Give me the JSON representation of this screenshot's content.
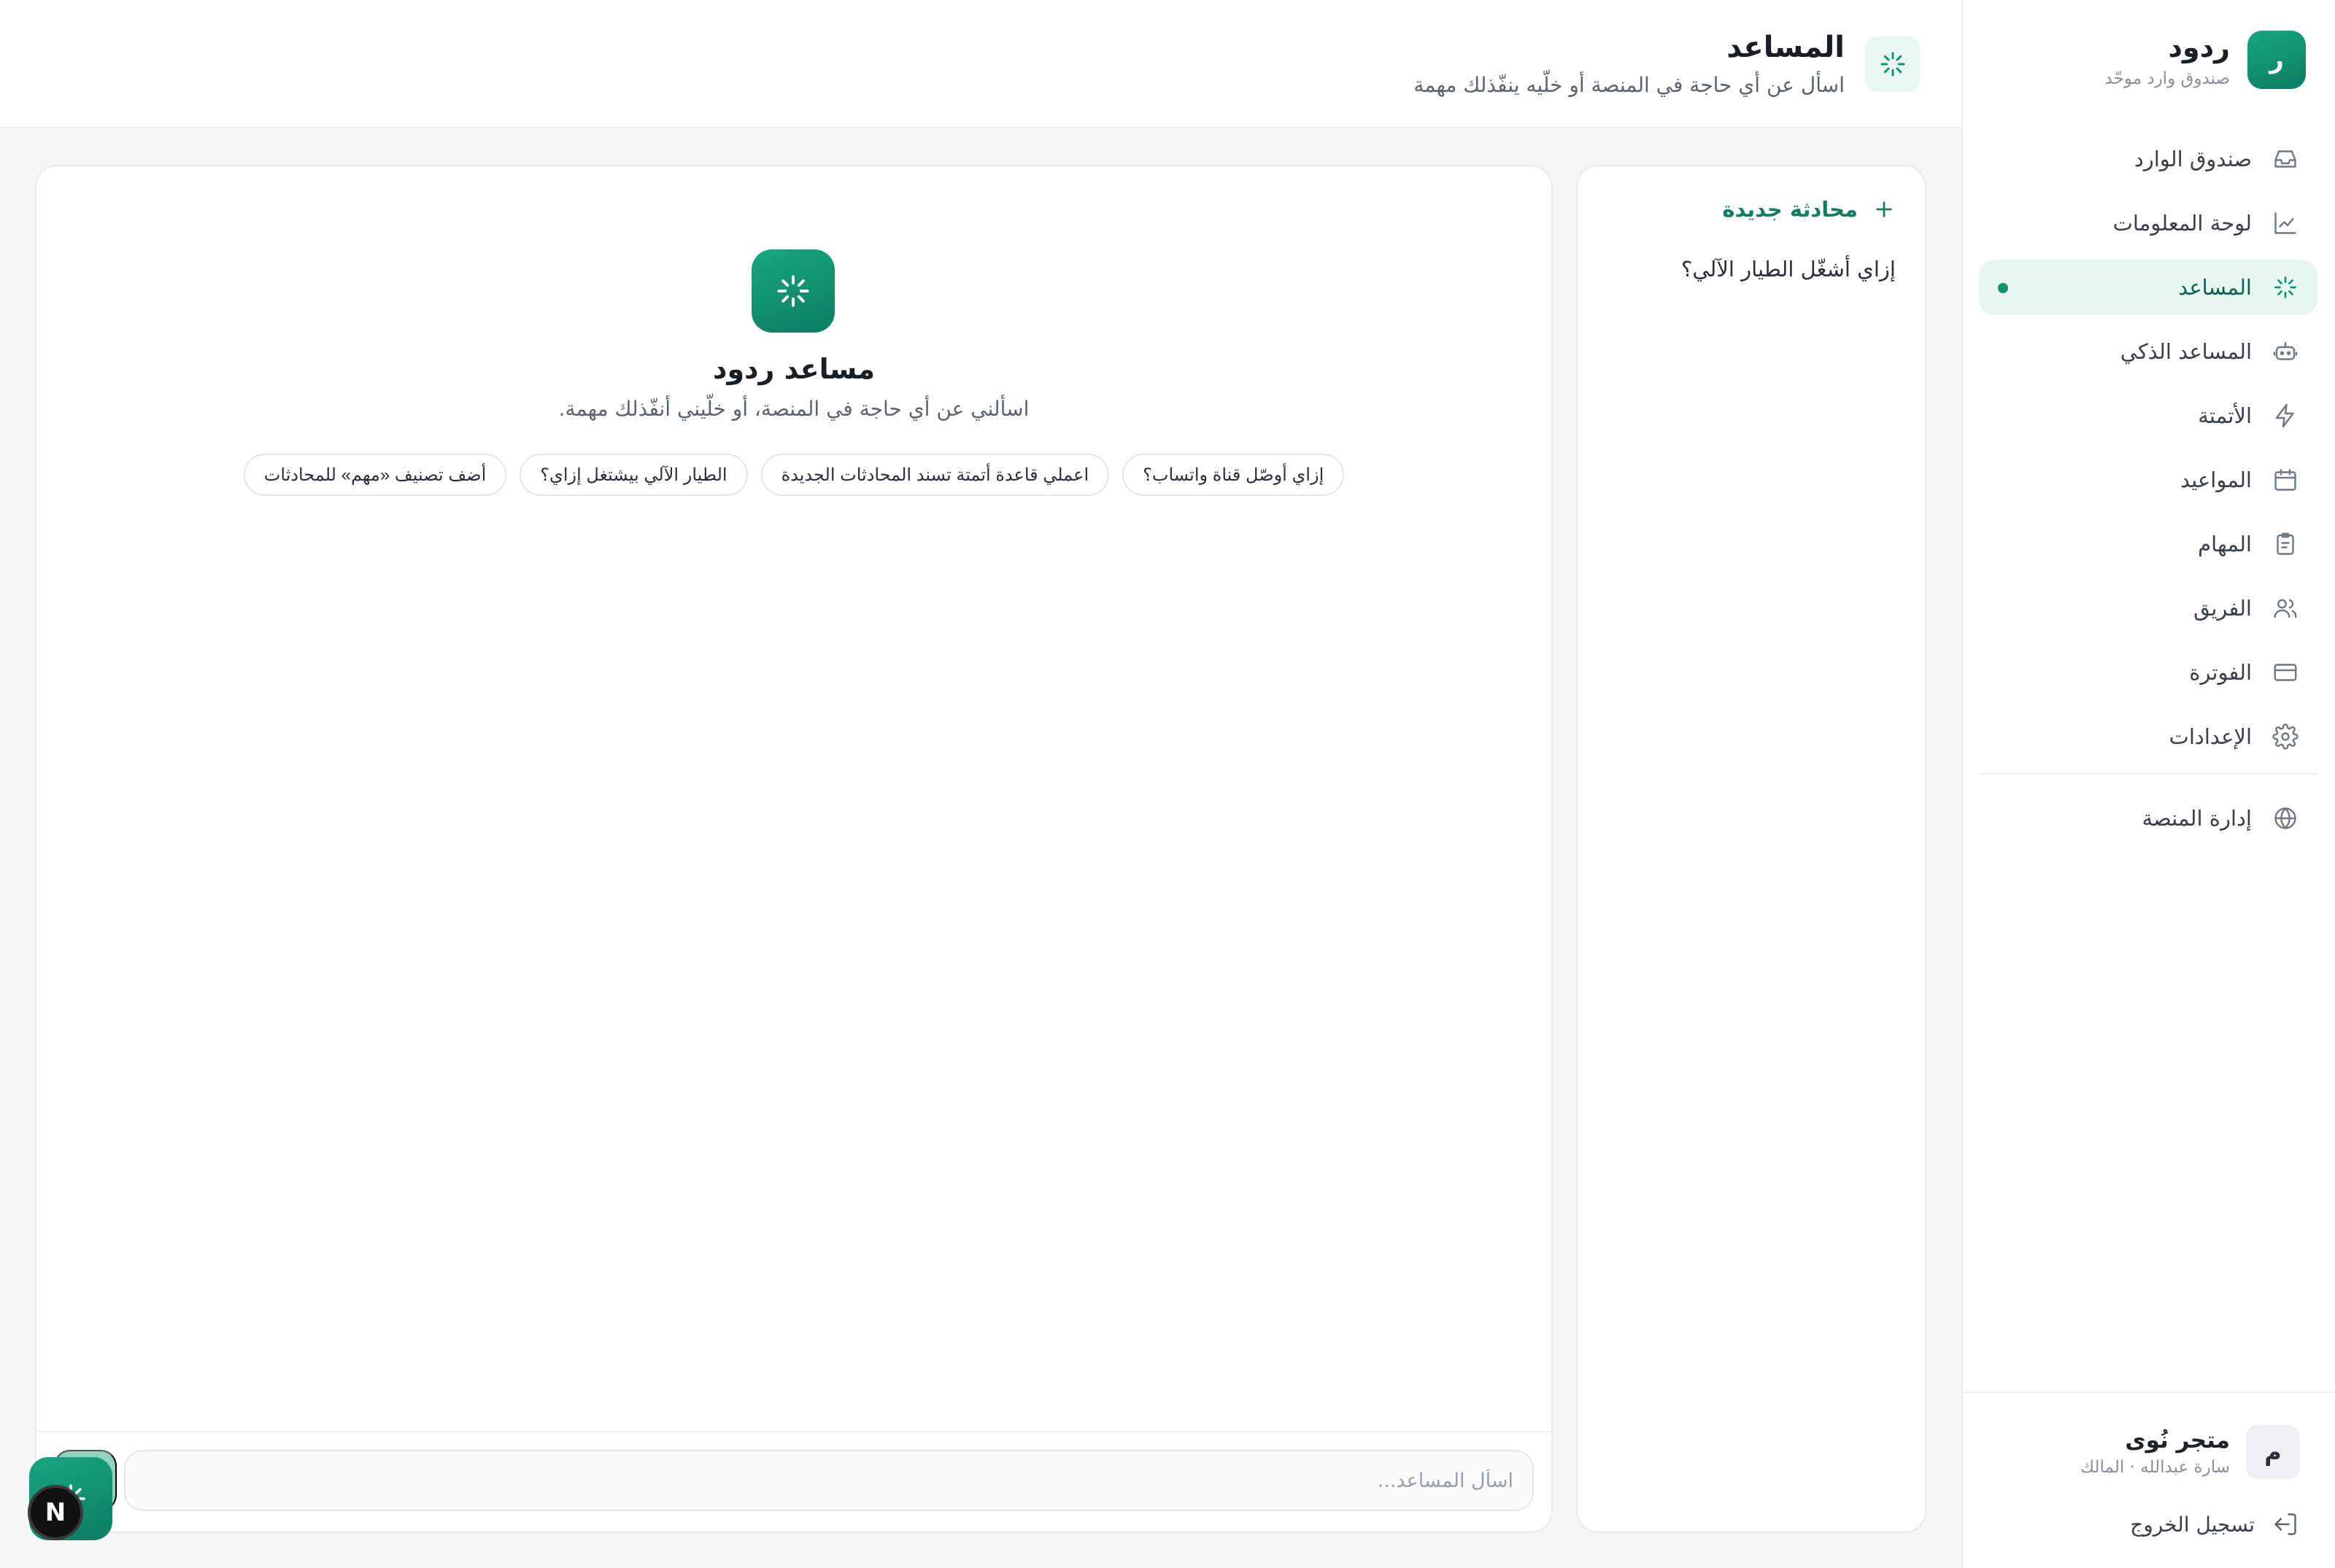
{
  "brand": {
    "name": "ردود",
    "subtitle": "صندوق وارد موحّد",
    "logo_letter": "ر"
  },
  "nav": {
    "items": [
      {
        "label": "صندوق الوارد",
        "icon": "inbox-icon"
      },
      {
        "label": "لوحة المعلومات",
        "icon": "chart-line-icon"
      },
      {
        "label": "المساعد",
        "icon": "sparkle-icon",
        "active": true
      },
      {
        "label": "المساعد الذكي",
        "icon": "bot-icon"
      },
      {
        "label": "الأتمتة",
        "icon": "lightning-icon"
      },
      {
        "label": "المواعيد",
        "icon": "calendar-icon"
      },
      {
        "label": "المهام",
        "icon": "clipboard-icon"
      },
      {
        "label": "الفريق",
        "icon": "users-icon"
      },
      {
        "label": "الفوترة",
        "icon": "credit-card-icon"
      },
      {
        "label": "الإعدادات",
        "icon": "gear-icon"
      }
    ],
    "admin": {
      "label": "إدارة المنصة",
      "icon": "globe-icon"
    }
  },
  "account": {
    "avatar_letter": "م",
    "name": "متجر نُوى",
    "subtitle": "سارة عبدالله · المالك",
    "logout_label": "تسجيل الخروج"
  },
  "header": {
    "title": "المساعد",
    "subtitle": "اسأل عن أي حاجة في المنصة أو خلّيه ينفّذلك مهمة"
  },
  "conversations": {
    "new_label": "محادثة جديدة",
    "items": [
      "إزاي أشغّل الطيار الآلي؟"
    ]
  },
  "chat": {
    "bot_name": "مساعد ردود",
    "bot_subtitle": "اسألني عن أي حاجة في المنصة، أو خلّيني أنفّذلك مهمة.",
    "suggestions": [
      "إزاي أوصّل قناة واتساب؟",
      "اعملي قاعدة أتمتة تسند المحادثات الجديدة",
      "الطيار الآلي بيشتغل إزاي؟",
      "أضف تصنيف «مهم» للمحادثات"
    ],
    "input_placeholder": "اسأل المساعد..."
  },
  "dev_badge": "N",
  "colors": {
    "accent": "#12936f",
    "accent_dark": "#0b7d62",
    "active_bg": "#e7f6f1"
  }
}
